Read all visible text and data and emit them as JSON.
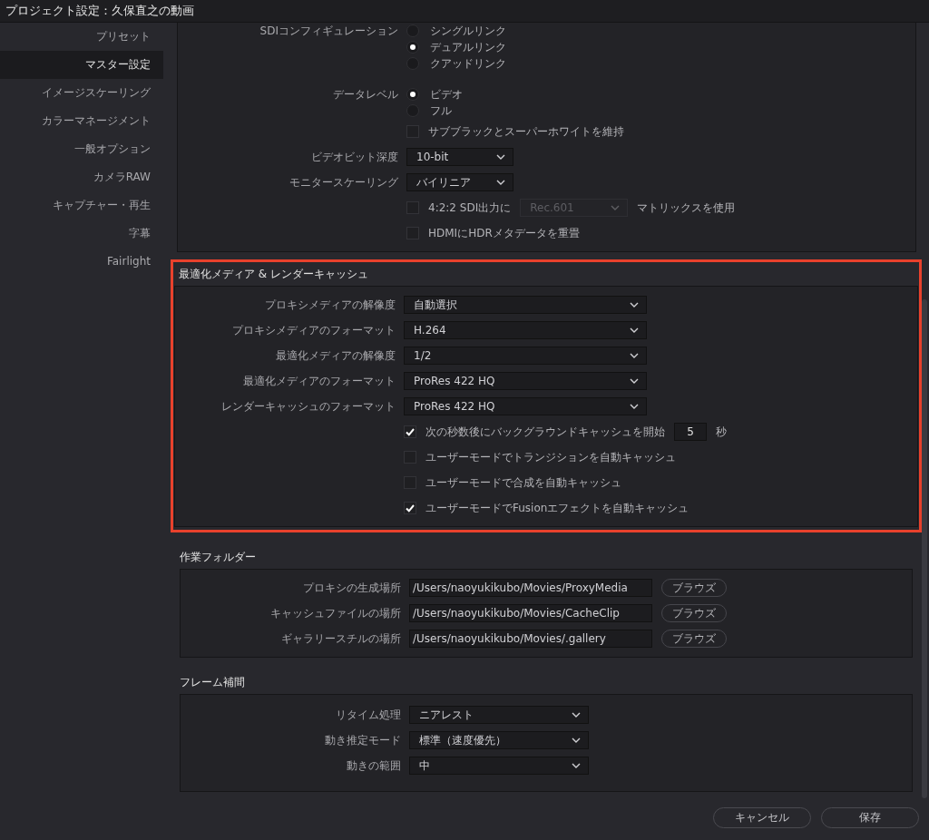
{
  "window": {
    "title": "プロジェクト設定：久保直之の動画"
  },
  "sidebar": {
    "items": [
      {
        "label": "プリセット",
        "selected": false
      },
      {
        "label": "マスター設定",
        "selected": true
      },
      {
        "label": "イメージスケーリング",
        "selected": false
      },
      {
        "label": "カラーマネージメント",
        "selected": false
      },
      {
        "label": "一般オプション",
        "selected": false
      },
      {
        "label": "カメラRAW",
        "selected": false
      },
      {
        "label": "キャプチャー・再生",
        "selected": false
      },
      {
        "label": "字幕",
        "selected": false
      },
      {
        "label": "Fairlight",
        "selected": false
      }
    ]
  },
  "video_panel": {
    "rows": [
      {
        "kind": "radio",
        "label": "SDIコンフィギュレーション",
        "options": [
          {
            "label": "シングルリンク",
            "selected": false
          },
          {
            "label": "デュアルリンク",
            "selected": true
          },
          {
            "label": "クアッドリンク",
            "selected": false
          }
        ]
      },
      {
        "kind": "radio",
        "label": "データレベル",
        "options": [
          {
            "label": "ビデオ",
            "selected": true
          },
          {
            "label": "フル",
            "selected": false
          }
        ]
      },
      {
        "kind": "checkbox",
        "text": "サブブラックとスーパーホワイトを維持",
        "checked": false
      },
      {
        "kind": "dropdown",
        "label": "ビデオビット深度",
        "value": "10-bit"
      },
      {
        "kind": "dropdown",
        "label": "モニタースケーリング",
        "value": "バイリニア"
      },
      {
        "kind": "checkbox_dropdown",
        "text": "4:2:2 SDI出力に",
        "checked": false,
        "value": "Rec.601",
        "disabled": true,
        "suffix": "マトリックスを使用"
      },
      {
        "kind": "checkbox",
        "text": "HDMIにHDRメタデータを重畳",
        "checked": false
      }
    ]
  },
  "sections": [
    {
      "title": "最適化メディア & レンダーキャッシュ",
      "highlighted": true,
      "rows": [
        {
          "kind": "dropdown",
          "label": "プロキシメディアの解像度",
          "value": "自動選択"
        },
        {
          "kind": "dropdown",
          "label": "プロキシメディアのフォーマット",
          "value": "H.264"
        },
        {
          "kind": "dropdown",
          "label": "最適化メディアの解像度",
          "value": "1/2"
        },
        {
          "kind": "dropdown",
          "label": "最適化メディアのフォーマット",
          "value": "ProRes 422 HQ"
        },
        {
          "kind": "dropdown",
          "label": "レンダーキャッシュのフォーマット",
          "value": "ProRes 422 HQ"
        },
        {
          "kind": "checkbox_number",
          "text": "次の秒数後にバックグラウンドキャッシュを開始",
          "checked": true,
          "value": "5",
          "unit": "秒"
        },
        {
          "kind": "checkbox",
          "text": "ユーザーモードでトランジションを自動キャッシュ",
          "checked": false
        },
        {
          "kind": "checkbox",
          "text": "ユーザーモードで合成を自動キャッシュ",
          "checked": false
        },
        {
          "kind": "checkbox",
          "text": "ユーザーモードでFusionエフェクトを自動キャッシュ",
          "checked": true
        }
      ]
    },
    {
      "title": "作業フォルダー",
      "highlighted": false,
      "rows": [
        {
          "kind": "path",
          "label": "プロキシの生成場所",
          "value": "/Users/naoyukikubo/Movies/ProxyMedia",
          "button": "ブラウズ"
        },
        {
          "kind": "path",
          "label": "キャッシュファイルの場所",
          "value": "/Users/naoyukikubo/Movies/CacheClip",
          "button": "ブラウズ"
        },
        {
          "kind": "path",
          "label": "ギャラリースチルの場所",
          "value": "/Users/naoyukikubo/Movies/.gallery",
          "button": "ブラウズ"
        }
      ]
    },
    {
      "title": "フレーム補間",
      "highlighted": false,
      "rows": [
        {
          "kind": "dropdown",
          "label": "リタイム処理",
          "value": "ニアレスト"
        },
        {
          "kind": "dropdown",
          "label": "動き推定モード",
          "value": "標準（速度優先）"
        },
        {
          "kind": "dropdown",
          "label": "動きの範囲",
          "value": "中"
        }
      ]
    }
  ],
  "footer": {
    "buttons": [
      "キャンセル",
      "保存"
    ]
  }
}
